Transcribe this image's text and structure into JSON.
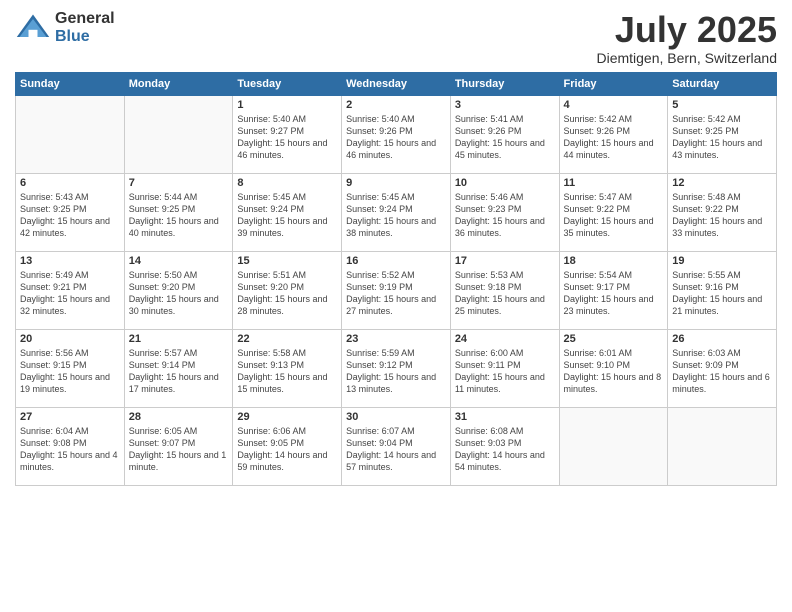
{
  "logo": {
    "general": "General",
    "blue": "Blue"
  },
  "title": "July 2025",
  "subtitle": "Diemtigen, Bern, Switzerland",
  "days_of_week": [
    "Sunday",
    "Monday",
    "Tuesday",
    "Wednesday",
    "Thursday",
    "Friday",
    "Saturday"
  ],
  "weeks": [
    [
      {
        "day": "",
        "info": ""
      },
      {
        "day": "",
        "info": ""
      },
      {
        "day": "1",
        "info": "Sunrise: 5:40 AM\nSunset: 9:27 PM\nDaylight: 15 hours and 46 minutes."
      },
      {
        "day": "2",
        "info": "Sunrise: 5:40 AM\nSunset: 9:26 PM\nDaylight: 15 hours and 46 minutes."
      },
      {
        "day": "3",
        "info": "Sunrise: 5:41 AM\nSunset: 9:26 PM\nDaylight: 15 hours and 45 minutes."
      },
      {
        "day": "4",
        "info": "Sunrise: 5:42 AM\nSunset: 9:26 PM\nDaylight: 15 hours and 44 minutes."
      },
      {
        "day": "5",
        "info": "Sunrise: 5:42 AM\nSunset: 9:25 PM\nDaylight: 15 hours and 43 minutes."
      }
    ],
    [
      {
        "day": "6",
        "info": "Sunrise: 5:43 AM\nSunset: 9:25 PM\nDaylight: 15 hours and 42 minutes."
      },
      {
        "day": "7",
        "info": "Sunrise: 5:44 AM\nSunset: 9:25 PM\nDaylight: 15 hours and 40 minutes."
      },
      {
        "day": "8",
        "info": "Sunrise: 5:45 AM\nSunset: 9:24 PM\nDaylight: 15 hours and 39 minutes."
      },
      {
        "day": "9",
        "info": "Sunrise: 5:45 AM\nSunset: 9:24 PM\nDaylight: 15 hours and 38 minutes."
      },
      {
        "day": "10",
        "info": "Sunrise: 5:46 AM\nSunset: 9:23 PM\nDaylight: 15 hours and 36 minutes."
      },
      {
        "day": "11",
        "info": "Sunrise: 5:47 AM\nSunset: 9:22 PM\nDaylight: 15 hours and 35 minutes."
      },
      {
        "day": "12",
        "info": "Sunrise: 5:48 AM\nSunset: 9:22 PM\nDaylight: 15 hours and 33 minutes."
      }
    ],
    [
      {
        "day": "13",
        "info": "Sunrise: 5:49 AM\nSunset: 9:21 PM\nDaylight: 15 hours and 32 minutes."
      },
      {
        "day": "14",
        "info": "Sunrise: 5:50 AM\nSunset: 9:20 PM\nDaylight: 15 hours and 30 minutes."
      },
      {
        "day": "15",
        "info": "Sunrise: 5:51 AM\nSunset: 9:20 PM\nDaylight: 15 hours and 28 minutes."
      },
      {
        "day": "16",
        "info": "Sunrise: 5:52 AM\nSunset: 9:19 PM\nDaylight: 15 hours and 27 minutes."
      },
      {
        "day": "17",
        "info": "Sunrise: 5:53 AM\nSunset: 9:18 PM\nDaylight: 15 hours and 25 minutes."
      },
      {
        "day": "18",
        "info": "Sunrise: 5:54 AM\nSunset: 9:17 PM\nDaylight: 15 hours and 23 minutes."
      },
      {
        "day": "19",
        "info": "Sunrise: 5:55 AM\nSunset: 9:16 PM\nDaylight: 15 hours and 21 minutes."
      }
    ],
    [
      {
        "day": "20",
        "info": "Sunrise: 5:56 AM\nSunset: 9:15 PM\nDaylight: 15 hours and 19 minutes."
      },
      {
        "day": "21",
        "info": "Sunrise: 5:57 AM\nSunset: 9:14 PM\nDaylight: 15 hours and 17 minutes."
      },
      {
        "day": "22",
        "info": "Sunrise: 5:58 AM\nSunset: 9:13 PM\nDaylight: 15 hours and 15 minutes."
      },
      {
        "day": "23",
        "info": "Sunrise: 5:59 AM\nSunset: 9:12 PM\nDaylight: 15 hours and 13 minutes."
      },
      {
        "day": "24",
        "info": "Sunrise: 6:00 AM\nSunset: 9:11 PM\nDaylight: 15 hours and 11 minutes."
      },
      {
        "day": "25",
        "info": "Sunrise: 6:01 AM\nSunset: 9:10 PM\nDaylight: 15 hours and 8 minutes."
      },
      {
        "day": "26",
        "info": "Sunrise: 6:03 AM\nSunset: 9:09 PM\nDaylight: 15 hours and 6 minutes."
      }
    ],
    [
      {
        "day": "27",
        "info": "Sunrise: 6:04 AM\nSunset: 9:08 PM\nDaylight: 15 hours and 4 minutes."
      },
      {
        "day": "28",
        "info": "Sunrise: 6:05 AM\nSunset: 9:07 PM\nDaylight: 15 hours and 1 minute."
      },
      {
        "day": "29",
        "info": "Sunrise: 6:06 AM\nSunset: 9:05 PM\nDaylight: 14 hours and 59 minutes."
      },
      {
        "day": "30",
        "info": "Sunrise: 6:07 AM\nSunset: 9:04 PM\nDaylight: 14 hours and 57 minutes."
      },
      {
        "day": "31",
        "info": "Sunrise: 6:08 AM\nSunset: 9:03 PM\nDaylight: 14 hours and 54 minutes."
      },
      {
        "day": "",
        "info": ""
      },
      {
        "day": "",
        "info": ""
      }
    ]
  ]
}
